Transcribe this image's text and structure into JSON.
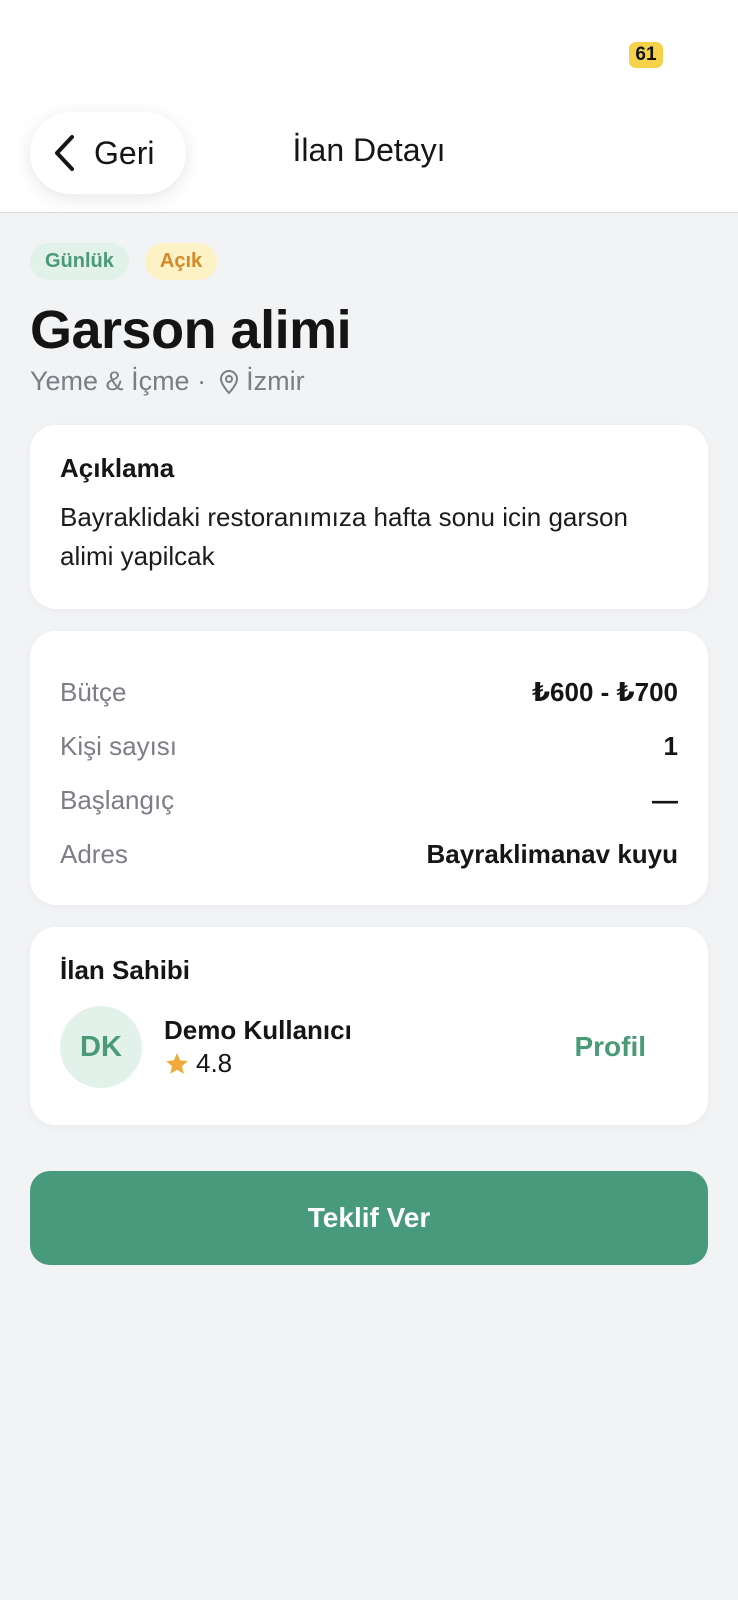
{
  "status_bar": {
    "battery": "61"
  },
  "nav": {
    "back_label": "Geri",
    "title": "İlan Detayı"
  },
  "badges": [
    {
      "label": "Günlük",
      "color": "#4a9a78"
    },
    {
      "label": "Açık",
      "color": "#d48a26"
    }
  ],
  "listing": {
    "title": "Garson alimi",
    "category": "Yeme & İçme ·",
    "location": "İzmir"
  },
  "description": {
    "heading": "Açıklama",
    "text": "Bayraklidaki restoranımıza hafta sonu icin garson alimi yapilcak"
  },
  "details": [
    {
      "label": "Bütçe",
      "value": "₺600 - ₺700"
    },
    {
      "label": "Kişi sayısı",
      "value": "1"
    },
    {
      "label": "Başlangıç",
      "value": "—"
    },
    {
      "label": "Adres",
      "value": "Bayraklimanav kuyu"
    }
  ],
  "owner": {
    "heading": "İlan Sahibi",
    "initials": "DK",
    "name": "Demo Kullanıcı",
    "rating": "4.8",
    "profile_label": "Profil"
  },
  "cta": {
    "label": "Teklif Ver"
  },
  "colors": {
    "accent": "#479b7c",
    "star": "#f0a93b",
    "battery": "#f5d24a"
  }
}
